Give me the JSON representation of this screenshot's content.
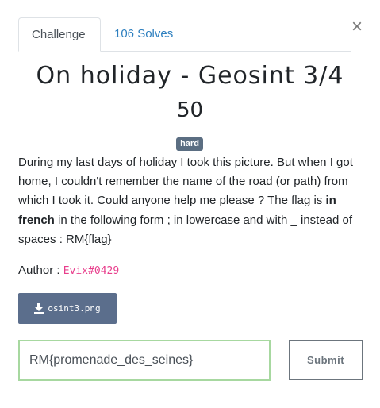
{
  "tabs": [
    {
      "label": "Challenge",
      "active": true
    },
    {
      "label": "106 Solves",
      "active": false
    }
  ],
  "close_glyph": "×",
  "challenge": {
    "title": "On holiday - Geosint 3/4",
    "points": "50",
    "difficulty": "hard",
    "description": {
      "part1": "During my last days of holiday I took this picture. But when I got home, I couldn't remember the name of the road (or path) from which I took it. Could anyone help me please ? The flag is ",
      "bold": "in french",
      "part2": " in the following form ; in lowercase and with _ instead of spaces : RM{flag}"
    },
    "author_label": "Author : ",
    "author_name": "Evix#0429"
  },
  "file": {
    "name": "osint3.png",
    "icon": "download-icon"
  },
  "submission": {
    "value": "RM{promenade_des_seines}",
    "submit_label": "Submit"
  },
  "colors": {
    "tab_link": "#2d7fbf",
    "badge_bg": "#5b6e82",
    "author_name": "#e83e8c",
    "file_button_bg": "#5b6e8c",
    "input_border": "#a7d8a0"
  }
}
